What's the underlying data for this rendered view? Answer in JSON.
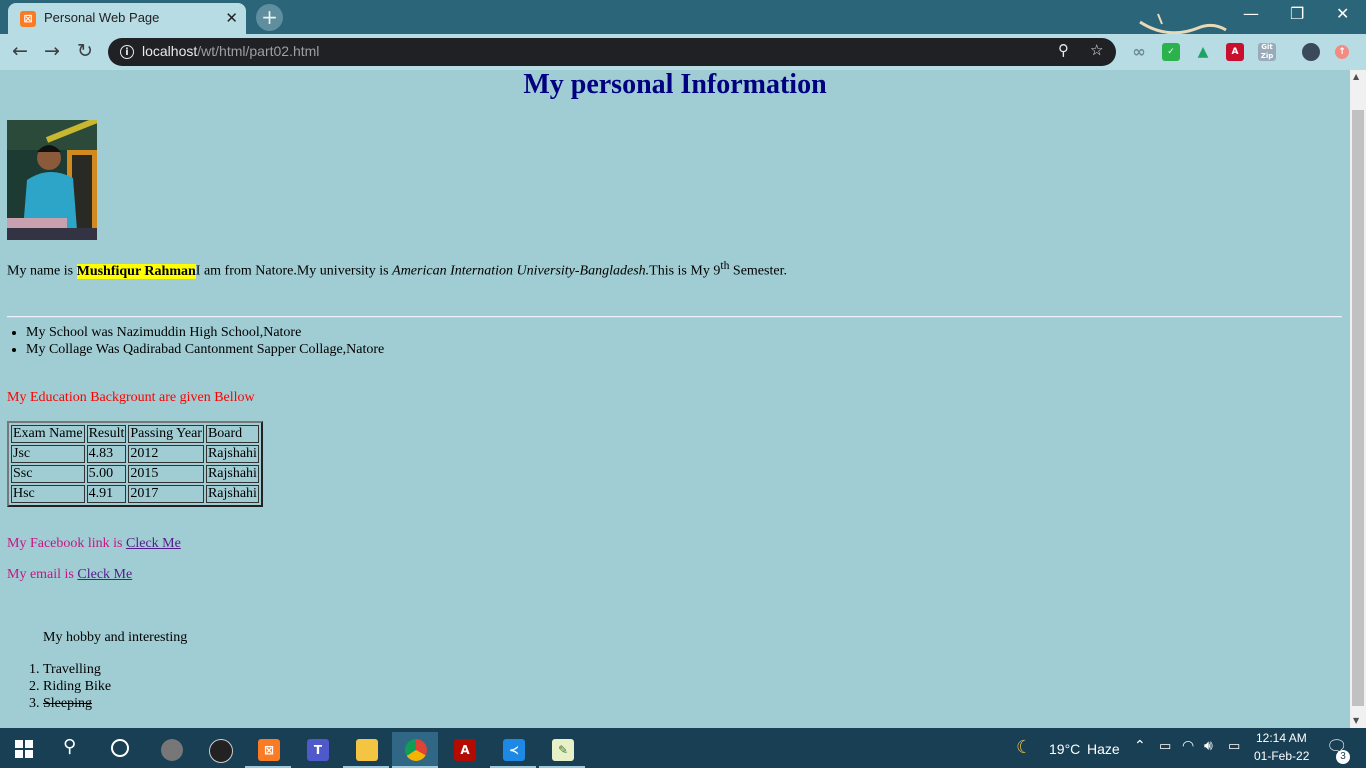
{
  "browser": {
    "tab_title": "Personal Web Page",
    "tab_close": "✕",
    "new_tab": "+",
    "url_host": "localhost",
    "url_path": "/wt/html/part02.html"
  },
  "page": {
    "heading": "My personal Information",
    "intro": {
      "pre": "My name is ",
      "name": "Mushfiqur Rahman",
      "mid": "I am from Natore.My university is ",
      "university": "American Internation University-Bangladesh.",
      "post1": "This is My 9",
      "sup": "th",
      "post2": " Semester."
    },
    "schools": [
      "My School was Nazimuddin High School,Natore",
      "My Collage Was Qadirabad Cantonment Sapper Collage,Natore"
    ],
    "education_heading": "My Education Backgrount are given Bellow",
    "table": {
      "headers": [
        "Exam Name",
        "Result",
        "Passing Year",
        "Board"
      ],
      "rows": [
        [
          "Jsc",
          "4.83",
          "2012",
          "Rajshahi"
        ],
        [
          "Ssc",
          "5.00",
          "2015",
          "Rajshahi"
        ],
        [
          "Hsc",
          "4.91",
          "2017",
          "Rajshahi"
        ]
      ]
    },
    "facebook": {
      "label": "My Facebook link is ",
      "link": "Cleck Me"
    },
    "email": {
      "label": "My email is ",
      "link": "Cleck Me"
    },
    "hobby_heading": "My hobby and interesting",
    "hobbies": [
      "Travelling",
      "Riding Bike",
      "Sleeping"
    ]
  },
  "taskbar": {
    "weather_temp": "19°C",
    "weather_text": "Haze",
    "time": "12:14 AM",
    "date": "01-Feb-22",
    "notification_count": "3"
  }
}
